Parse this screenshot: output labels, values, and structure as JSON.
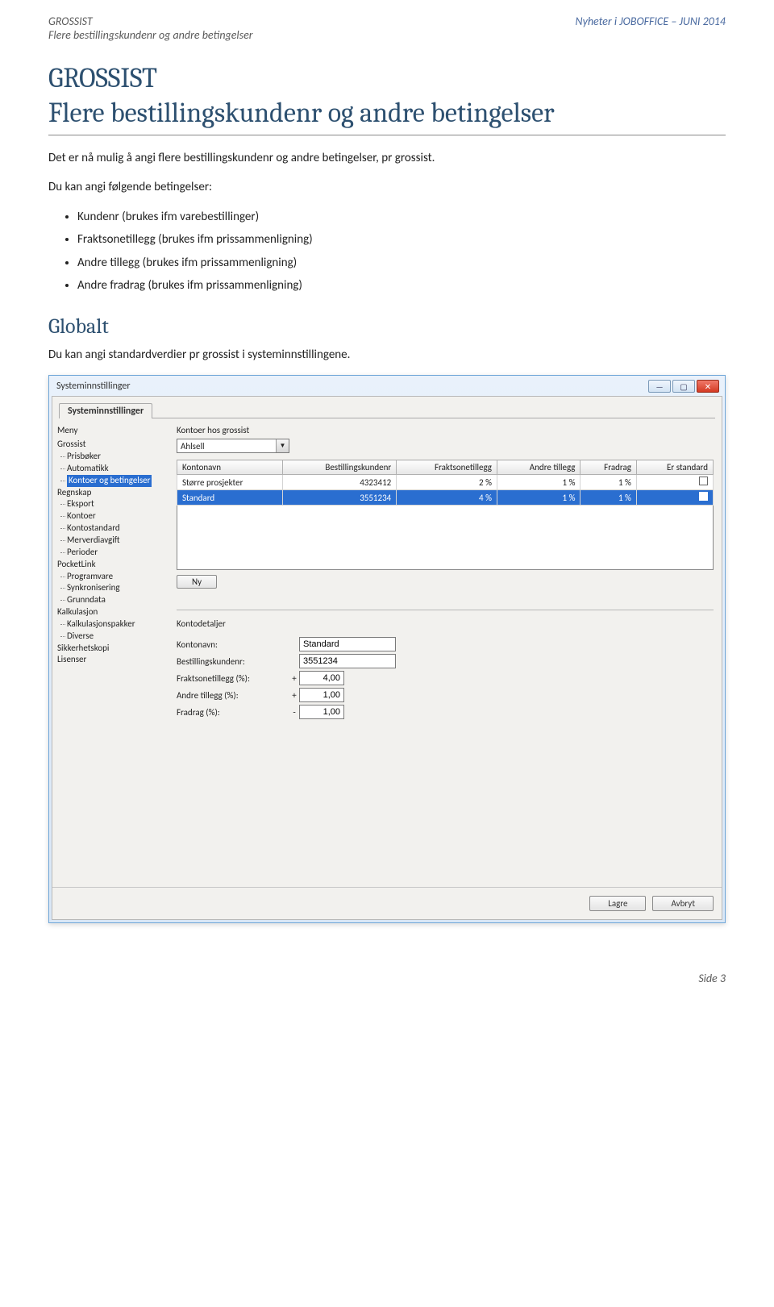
{
  "header": {
    "left_line1": "GROSSIST",
    "left_line2": "Flere bestillingskundenr og andre betingelser",
    "right": "Nyheter i JOBOFFICE – JUNI 2014"
  },
  "title_line1": "GROSSIST",
  "title_line2": "Flere bestillingskundenr og andre betingelser",
  "intro": "Det er nå mulig å angi flere bestillingskundenr og andre betingelser, pr grossist.",
  "subintro": "Du kan angi følgende betingelser:",
  "bullets": [
    "Kundenr (brukes ifm varebestillinger)",
    "Fraktsonetillegg (brukes ifm prissammenligning)",
    "Andre tillegg (brukes ifm prissammenligning)",
    "Andre fradrag (brukes ifm prissammenligning)"
  ],
  "section_title": "Globalt",
  "section_text": "Du kan angi standardverdier pr grossist i systeminnstillingene.",
  "window": {
    "title": "Systeminnstillinger",
    "tab": "Systeminnstillinger",
    "sidebar_label": "Meny",
    "tree": [
      {
        "label": "Grossist",
        "level": 0
      },
      {
        "label": "Prisbøker",
        "level": 1
      },
      {
        "label": "Automatikk",
        "level": 1
      },
      {
        "label": "Kontoer og betingelser",
        "level": 1,
        "selected": true
      },
      {
        "label": "Regnskap",
        "level": 0
      },
      {
        "label": "Eksport",
        "level": 1
      },
      {
        "label": "Kontoer",
        "level": 1
      },
      {
        "label": "Kontostandard",
        "level": 1
      },
      {
        "label": "Merverdiavgift",
        "level": 1
      },
      {
        "label": "Perioder",
        "level": 1
      },
      {
        "label": "PocketLink",
        "level": 0
      },
      {
        "label": "Programvare",
        "level": 1
      },
      {
        "label": "Synkronisering",
        "level": 1
      },
      {
        "label": "Grunndata",
        "level": 1
      },
      {
        "label": "Kalkulasjon",
        "level": 0
      },
      {
        "label": "Kalkulasjonspakker",
        "level": 1
      },
      {
        "label": "Diverse",
        "level": 1
      },
      {
        "label": "Sikkerhetskopi",
        "level": 0
      },
      {
        "label": "Lisenser",
        "level": 0
      }
    ],
    "main": {
      "section_label": "Kontoer hos grossist",
      "combo_value": "Ahlsell",
      "columns": [
        "Kontonavn",
        "Bestillingskundenr",
        "Fraktsonetillegg",
        "Andre tillegg",
        "Fradrag",
        "Er standard"
      ],
      "rows": [
        {
          "name": "Større prosjekter",
          "kundenr": "4323412",
          "frakt": "2 %",
          "tillegg": "1 %",
          "fradrag": "1 %",
          "std": false,
          "sel": false
        },
        {
          "name": "Standard",
          "kundenr": "3551234",
          "frakt": "4 %",
          "tillegg": "1 %",
          "fradrag": "1 %",
          "std": true,
          "sel": true
        }
      ],
      "new_button": "Ny",
      "details_label": "Kontodetaljer",
      "form": {
        "kontonavn_label": "Kontonavn:",
        "kontonavn_value": "Standard",
        "kundenr_label": "Bestillingskundenr:",
        "kundenr_value": "3551234",
        "frakt_label": "Fraktsonetillegg (%):",
        "frakt_sign": "+",
        "frakt_value": "4,00",
        "tillegg_label": "Andre tillegg (%):",
        "tillegg_sign": "+",
        "tillegg_value": "1,00",
        "fradrag_label": "Fradrag (%):",
        "fradrag_sign": "-",
        "fradrag_value": "1,00"
      }
    },
    "footer": {
      "save": "Lagre",
      "cancel": "Avbryt"
    }
  },
  "page_footer": "Side 3"
}
